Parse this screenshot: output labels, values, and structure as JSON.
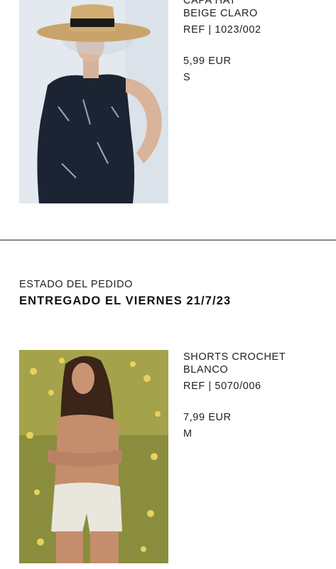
{
  "items_top": {
    "product_name_partial": "CAPA HAT",
    "color": "BEIGE CLARO",
    "ref": "REF | 1023/002",
    "price": "5,99 EUR",
    "size": "S"
  },
  "order_status": {
    "label": "ESTADO DEL PEDIDO",
    "value": "ENTREGADO EL VIERNES 21/7/23"
  },
  "items_bottom": {
    "product_name_line1": "SHORTS CROCHET",
    "product_name_line2": "BLANCO",
    "ref": "REF | 5070/006",
    "price": "7,99 EUR",
    "size": "M"
  },
  "colors": {
    "divider": "#2a2a2a",
    "background": "#ffffff"
  }
}
